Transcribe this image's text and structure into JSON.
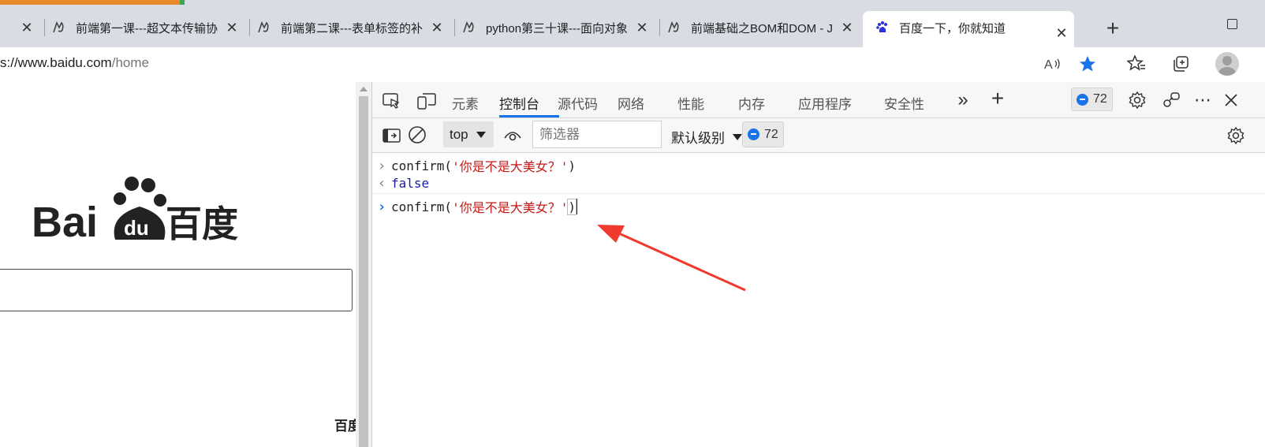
{
  "browser": {
    "tabs": [
      {
        "title": "前端第一课---超文本传输协",
        "active": false
      },
      {
        "title": "前端第二课---表单标签的补",
        "active": false
      },
      {
        "title": "python第三十课---面向对象",
        "active": false
      },
      {
        "title": "前端基础之BOM和DOM - Ja",
        "active": false
      },
      {
        "title": "百度一下，你就知道",
        "active": true
      }
    ],
    "close_glyph": "✕",
    "new_tab_glyph": "+",
    "address": {
      "prefix": "s://www.baidu.com",
      "path": "/home"
    },
    "icons": [
      "read-aloud-icon",
      "favorite-star-icon",
      "favorites-icon",
      "collections-icon",
      "profile-avatar-icon"
    ],
    "accent_color": "#1a73e8"
  },
  "page": {
    "logo_text_left": "Bai",
    "logo_text_du": "du",
    "logo_text_cn": "百度",
    "bottom_text": "百度"
  },
  "devtools": {
    "tabs": [
      "元素",
      "控制台",
      "源代码",
      "网络",
      "性能",
      "内存",
      "应用程序",
      "安全性"
    ],
    "active_tab": "控制台",
    "more_tabs_glyph": "»",
    "add_tab_glyph": "+",
    "issues_count": "72",
    "console_toolbar": {
      "context": "top",
      "filter_placeholder": "筛选器",
      "level": "默认级别",
      "issues_count": "72"
    },
    "console_lines": [
      {
        "kind": "input",
        "fn": "confirm(",
        "str": "'你是不是大美女？'",
        "close": ")"
      },
      {
        "kind": "output",
        "value": "false"
      },
      {
        "kind": "prompt",
        "fn": "confirm(",
        "str": "'你是不是大美女？'",
        "close": ")"
      }
    ],
    "annotation_color": "#f03a2e"
  }
}
